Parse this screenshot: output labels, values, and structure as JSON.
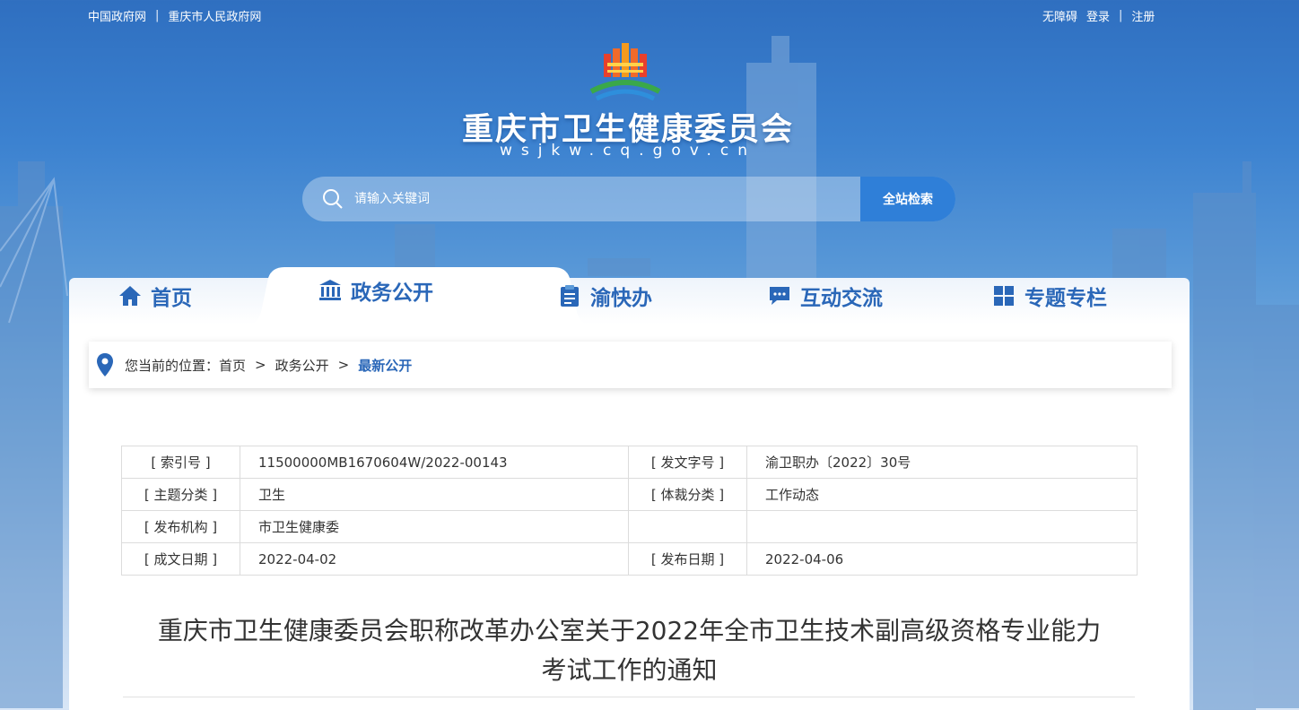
{
  "topbar": {
    "links_left": [
      "中国政府网",
      "重庆市人民政府网"
    ],
    "links_right": [
      "无障碍",
      "登录",
      "注册"
    ]
  },
  "header": {
    "title": "重庆市卫生健康委员会",
    "domain": "wsjkw.cq.gov.cn"
  },
  "search": {
    "placeholder": "请输入关键词",
    "button": "全站检索"
  },
  "nav": {
    "items": [
      {
        "label": "首页",
        "icon": "home-icon"
      },
      {
        "label": "政务公开",
        "icon": "government-icon",
        "active": true
      },
      {
        "label": "渝快办",
        "icon": "clipboard-icon"
      },
      {
        "label": "互动交流",
        "icon": "chat-icon"
      },
      {
        "label": "专题专栏",
        "icon": "grid-icon"
      }
    ]
  },
  "breadcrumb": {
    "prefix": "您当前的位置：",
    "items": [
      "首页",
      "政务公开",
      "最新公开"
    ],
    "separator": ">"
  },
  "meta": {
    "index_label": "[ 索引号 ]",
    "index_value": "11500000MB1670604W/2022-00143",
    "doc_no_label": "[ 发文字号 ]",
    "doc_no_value": "渝卫职办〔2022〕30号",
    "topic_label": "[ 主题分类 ]",
    "topic_value": "卫生",
    "genre_label": "[ 体裁分类 ]",
    "genre_value": "工作动态",
    "publisher_label": "[ 发布机构 ]",
    "publisher_value": "市卫生健康委",
    "created_label": "[ 成文日期 ]",
    "created_value": "2022-04-02",
    "published_label": "[ 发布日期 ]",
    "published_value": "2022-04-06"
  },
  "article": {
    "title_line1": "重庆市卫生健康委员会职称改革办公室关于2022年全市卫生技术副高级资格专业能力",
    "title_line2": "考试工作的通知"
  },
  "colors": {
    "brand_blue": "#2a67b8",
    "button_blue": "#2f7fd8"
  }
}
